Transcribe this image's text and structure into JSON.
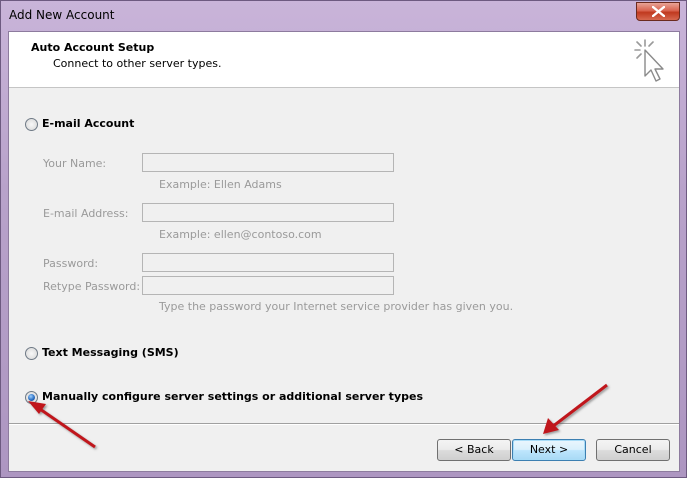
{
  "window": {
    "title": "Add New Account"
  },
  "header": {
    "title": "Auto Account Setup",
    "subtitle": "Connect to other server types.",
    "icon": "cursor-sparkle-icon"
  },
  "options": {
    "email_account": {
      "label": "E-mail Account",
      "selected": false,
      "fields": {
        "your_name": {
          "label": "Your Name:",
          "value": "",
          "hint": "Example: Ellen Adams"
        },
        "email_address": {
          "label": "E-mail Address:",
          "value": "",
          "hint": "Example: ellen@contoso.com"
        },
        "password": {
          "label": "Password:",
          "value": ""
        },
        "retype_password": {
          "label": "Retype Password:",
          "value": "",
          "hint": "Type the password your Internet service provider has given you."
        }
      }
    },
    "text_messaging": {
      "label": "Text Messaging (SMS)",
      "selected": false
    },
    "manual_configure": {
      "label": "Manually configure server settings or additional server types",
      "selected": true
    }
  },
  "buttons": {
    "back": "< Back",
    "next": "Next >",
    "cancel": "Cancel"
  },
  "colors": {
    "annotation_arrow": "#c0161b",
    "disabled_text": "#9a9a9a",
    "window_frame": "#b9a6c9"
  }
}
